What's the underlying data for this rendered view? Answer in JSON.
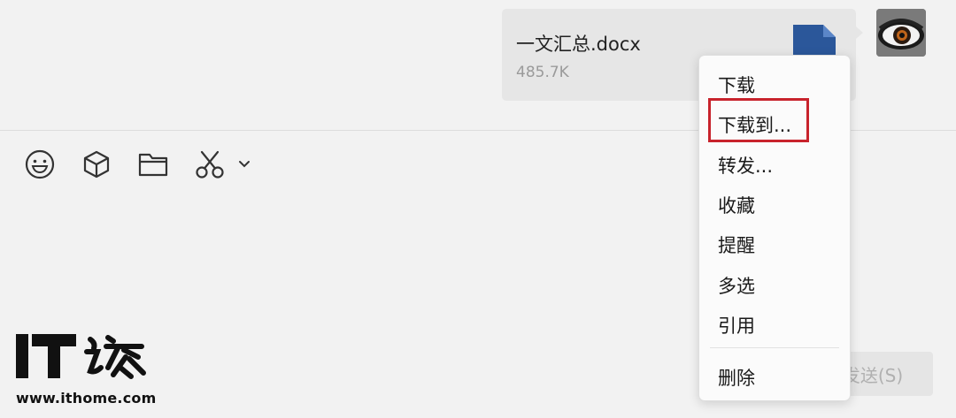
{
  "message": {
    "file_name": "一文汇总.docx",
    "file_size": "485.7K",
    "file_icon": "word-doc-icon"
  },
  "avatar": {
    "icon": "eye-avatar"
  },
  "toolbar": {
    "items": [
      {
        "icon": "emoji-icon"
      },
      {
        "icon": "cube-icon"
      },
      {
        "icon": "folder-icon"
      },
      {
        "icon": "scissors-icon"
      },
      {
        "icon": "chevron-down-icon"
      }
    ]
  },
  "context_menu": {
    "items": [
      {
        "label": "下载"
      },
      {
        "label": "下载到..."
      },
      {
        "label": "转发..."
      },
      {
        "label": "收藏"
      },
      {
        "label": "提醒"
      },
      {
        "label": "多选"
      },
      {
        "label": "引用"
      },
      {
        "label": "删除"
      }
    ],
    "highlighted_index": 1,
    "highlight_color": "#c8232c"
  },
  "send_button": {
    "label": "发送(S)"
  },
  "watermark": {
    "site": "www.ithome.com"
  }
}
